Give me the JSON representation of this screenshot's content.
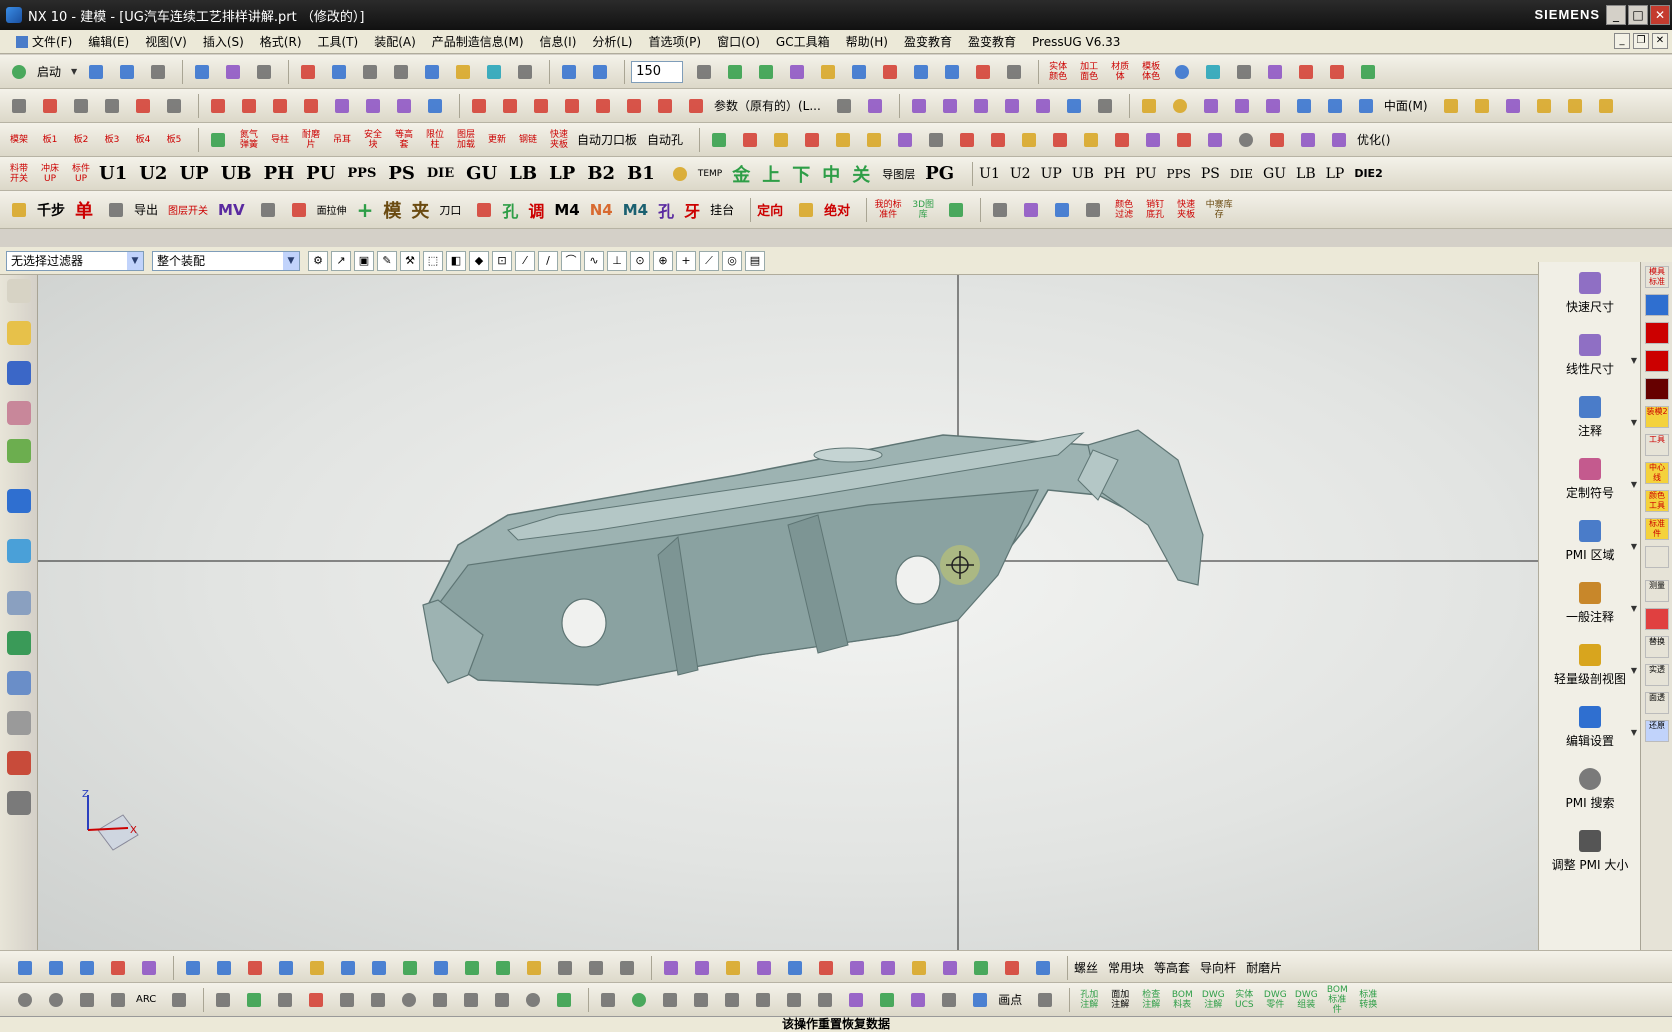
{
  "window": {
    "title": "NX 10 - 建模 - [UG汽车连续工艺排样讲解.prt （修改的）]",
    "brand": "SIEMENS",
    "min": "_",
    "max": "□",
    "close": "✕"
  },
  "menu": {
    "items": [
      "文件(F)",
      "编辑(E)",
      "视图(V)",
      "插入(S)",
      "格式(R)",
      "工具(T)",
      "装配(A)",
      "产品制造信息(M)",
      "信息(I)",
      "分析(L)",
      "首选项(P)",
      "窗口(O)",
      "GC工具箱",
      "帮助(H)",
      "盈变教育",
      "盈变教育",
      "PressUG V6.33"
    ]
  },
  "toolbar1": {
    "start_label": "启动",
    "zoom_value": "150"
  },
  "toolbar2": {
    "param_label": "参数（原有的）(L...",
    "midplane_label": "中面(M)"
  },
  "toolbar3": {
    "labels": [
      "氮气弹簧",
      "导柱",
      "耐磨片",
      "吊耳",
      "安全块",
      "等高套",
      "限位柱",
      "图层加载",
      "更新",
      "钢链",
      "快速夹板",
      "自动刀口板",
      "自动孔"
    ],
    "optimize_label": "优化()"
  },
  "toolbar4": {
    "big_labels": [
      "U1",
      "U2",
      "UP",
      "UB",
      "PH",
      "PU",
      "PPS",
      "PS",
      "DIE",
      "GU",
      "LB",
      "LP",
      "B2",
      "B1"
    ],
    "mid_labels": [
      "金",
      "上",
      "下",
      "中",
      "关"
    ],
    "extra_labels": [
      "TEMP",
      "导图层",
      "PG"
    ],
    "move_labels": [
      "U1",
      "U2",
      "UP",
      "UB",
      "PH",
      "PU",
      "PPS",
      "PS",
      "DIE",
      "GU",
      "LB",
      "LP"
    ],
    "die2_label": "DIE2"
  },
  "toolbar5": {
    "labels": [
      "千步",
      "单",
      "导出",
      "图层开关",
      "MV",
      "面拉伸",
      "模",
      "夹",
      "刀口",
      "孔",
      "调",
      "M4",
      "N4",
      "M4",
      "孔",
      "牙",
      "挂台",
      "定向",
      "绝对",
      "我的标准件",
      "3D图库",
      "中寨库存"
    ]
  },
  "selection_bar": {
    "filter_value": "无选择过滤器",
    "scope_value": "整个装配"
  },
  "pmi_panel": {
    "items": [
      "快速尺寸",
      "线性尺寸",
      "注释",
      "定制符号",
      "PMI 区域",
      "一般注释",
      "轻量级剖视图",
      "编辑设置",
      "PMI 搜索",
      "调整 PMI 大小"
    ]
  },
  "far_right": {
    "labels": [
      "模具标准",
      "",
      "",
      "",
      "",
      "装模2",
      "工具",
      "中心线",
      "颜色工具",
      "标准件",
      "",
      "测量",
      "",
      "替换",
      "实透",
      "面透",
      "还原"
    ]
  },
  "bottom1": {
    "labels": [
      "螺丝",
      "常用块",
      "等高套",
      "导向杆",
      "耐磨片"
    ]
  },
  "bottom2": {
    "labels": [
      "ARC",
      "画点",
      "孔加注解",
      "面加注解",
      "检查注解",
      "BOM料表",
      "DWG注解",
      "实体UCS",
      "DWG零件",
      "DWG组装",
      "BOM标准件",
      "标准转换"
    ]
  },
  "status": {
    "message": "该操作重置恢复数据"
  },
  "colors": {
    "part": "#9db3b2",
    "part_dark": "#6f8988",
    "viewport": "#e2e4e2",
    "accent_red": "#c00000"
  }
}
